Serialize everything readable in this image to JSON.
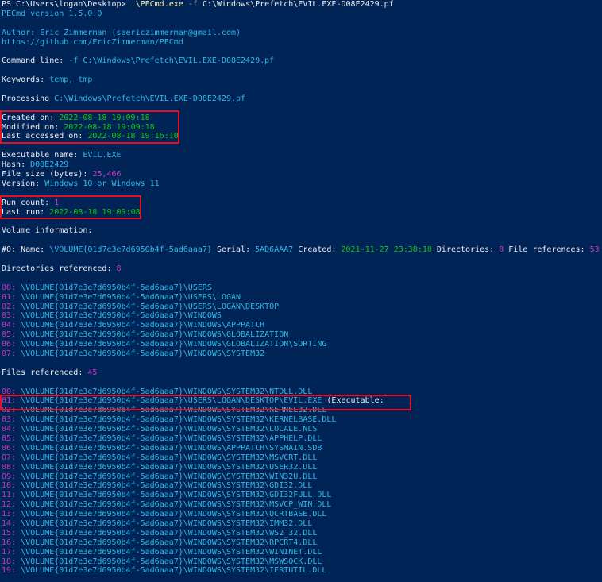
{
  "prompt": {
    "path": "PS C:\\Users\\logan\\Desktop> ",
    "command": ".\\PECmd.exe",
    "flag": "-f",
    "arg": "C:\\Windows\\Prefetch\\EVIL.EXE-D08E2429.pf"
  },
  "header": {
    "version": "PECmd version 1.5.0.0",
    "author": "Author: Eric Zimmerman (saericzimmerman@gmail.com)",
    "url": "https://github.com/EricZimmerman/PECmd"
  },
  "command_line": {
    "label": "Command line: ",
    "value": "-f C:\\Windows\\Prefetch\\EVIL.EXE-D08E2429.pf"
  },
  "keywords": {
    "label": "Keywords: ",
    "value": "temp, tmp"
  },
  "processing": {
    "label": "Processing ",
    "value": "C:\\Windows\\Prefetch\\EVIL.EXE-D08E2429.pf"
  },
  "timestamps": {
    "created_label": "Created on: ",
    "created": "2022-08-18 19:09:18",
    "modified_label": "Modified on: ",
    "modified": "2022-08-18 19:09:18",
    "accessed_label": "Last accessed on: ",
    "accessed": "2022-08-18 19:16:10"
  },
  "executable": {
    "name_label": "Executable name: ",
    "name": "EVIL.EXE",
    "hash_label": "Hash: ",
    "hash": "D08E2429",
    "size_label": "File size (bytes): ",
    "size": "25,466",
    "version_label": "Version: ",
    "version": "Windows 10 or Windows 11"
  },
  "run": {
    "count_label": "Run count: ",
    "count": "1",
    "last_label": "Last run: ",
    "last": "2022-08-18 19:09:08"
  },
  "volume": {
    "header": "Volume information:",
    "index": "#0: ",
    "name_label": "Name: ",
    "name": "\\VOLUME{01d7e3e7d6950b4f-5ad6aaa7}",
    "serial_label": " Serial: ",
    "serial": "5AD6AAA7",
    "created_label": " Created: ",
    "created": "2021-11-27 23:38:10",
    "dirs_label": " Directories: ",
    "dirs": "8",
    "files_label": " File references: ",
    "files": "53"
  },
  "directories": {
    "label": "Directories referenced: ",
    "count": "8",
    "items": [
      {
        "idx": "00: ",
        "path": "\\VOLUME{01d7e3e7d6950b4f-5ad6aaa7}\\USERS"
      },
      {
        "idx": "01: ",
        "path": "\\VOLUME{01d7e3e7d6950b4f-5ad6aaa7}\\USERS\\LOGAN"
      },
      {
        "idx": "02: ",
        "path": "\\VOLUME{01d7e3e7d6950b4f-5ad6aaa7}\\USERS\\LOGAN\\DESKTOP"
      },
      {
        "idx": "03: ",
        "path": "\\VOLUME{01d7e3e7d6950b4f-5ad6aaa7}\\WINDOWS"
      },
      {
        "idx": "04: ",
        "path": "\\VOLUME{01d7e3e7d6950b4f-5ad6aaa7}\\WINDOWS\\APPPATCH"
      },
      {
        "idx": "05: ",
        "path": "\\VOLUME{01d7e3e7d6950b4f-5ad6aaa7}\\WINDOWS\\GLOBALIZATION"
      },
      {
        "idx": "06: ",
        "path": "\\VOLUME{01d7e3e7d6950b4f-5ad6aaa7}\\WINDOWS\\GLOBALIZATION\\SORTING"
      },
      {
        "idx": "07: ",
        "path": "\\VOLUME{01d7e3e7d6950b4f-5ad6aaa7}\\WINDOWS\\SYSTEM32"
      }
    ]
  },
  "files": {
    "label": "Files referenced: ",
    "count": "45",
    "items": [
      {
        "idx": "00: ",
        "path": "\\VOLUME{01d7e3e7d6950b4f-5ad6aaa7}\\WINDOWS\\SYSTEM32\\NTDLL.DLL"
      },
      {
        "idx": "01: ",
        "path": "\\VOLUME{01d7e3e7d6950b4f-5ad6aaa7}\\USERS\\LOGAN\\DESKTOP\\EVIL.EXE",
        "suffix_open": " (Executable: ",
        "suffix_value": "True",
        "suffix_close": ")"
      },
      {
        "idx": "02: ",
        "path": "\\VOLUME{01d7e3e7d6950b4f-5ad6aaa7}\\WINDOWS\\SYSTEM32\\KERNEL32.DLL"
      },
      {
        "idx": "03: ",
        "path": "\\VOLUME{01d7e3e7d6950b4f-5ad6aaa7}\\WINDOWS\\SYSTEM32\\KERNELBASE.DLL"
      },
      {
        "idx": "04: ",
        "path": "\\VOLUME{01d7e3e7d6950b4f-5ad6aaa7}\\WINDOWS\\SYSTEM32\\LOCALE.NLS"
      },
      {
        "idx": "05: ",
        "path": "\\VOLUME{01d7e3e7d6950b4f-5ad6aaa7}\\WINDOWS\\SYSTEM32\\APPHELP.DLL"
      },
      {
        "idx": "06: ",
        "path": "\\VOLUME{01d7e3e7d6950b4f-5ad6aaa7}\\WINDOWS\\APPPATCH\\SYSMAIN.SDB"
      },
      {
        "idx": "07: ",
        "path": "\\VOLUME{01d7e3e7d6950b4f-5ad6aaa7}\\WINDOWS\\SYSTEM32\\MSVCRT.DLL"
      },
      {
        "idx": "08: ",
        "path": "\\VOLUME{01d7e3e7d6950b4f-5ad6aaa7}\\WINDOWS\\SYSTEM32\\USER32.DLL"
      },
      {
        "idx": "09: ",
        "path": "\\VOLUME{01d7e3e7d6950b4f-5ad6aaa7}\\WINDOWS\\SYSTEM32\\WIN32U.DLL"
      },
      {
        "idx": "10: ",
        "path": "\\VOLUME{01d7e3e7d6950b4f-5ad6aaa7}\\WINDOWS\\SYSTEM32\\GDI32.DLL"
      },
      {
        "idx": "11: ",
        "path": "\\VOLUME{01d7e3e7d6950b4f-5ad6aaa7}\\WINDOWS\\SYSTEM32\\GDI32FULL.DLL"
      },
      {
        "idx": "12: ",
        "path": "\\VOLUME{01d7e3e7d6950b4f-5ad6aaa7}\\WINDOWS\\SYSTEM32\\MSVCP_WIN.DLL"
      },
      {
        "idx": "13: ",
        "path": "\\VOLUME{01d7e3e7d6950b4f-5ad6aaa7}\\WINDOWS\\SYSTEM32\\UCRTBASE.DLL"
      },
      {
        "idx": "14: ",
        "path": "\\VOLUME{01d7e3e7d6950b4f-5ad6aaa7}\\WINDOWS\\SYSTEM32\\IMM32.DLL"
      },
      {
        "idx": "15: ",
        "path": "\\VOLUME{01d7e3e7d6950b4f-5ad6aaa7}\\WINDOWS\\SYSTEM32\\WS2_32.DLL"
      },
      {
        "idx": "16: ",
        "path": "\\VOLUME{01d7e3e7d6950b4f-5ad6aaa7}\\WINDOWS\\SYSTEM32\\RPCRT4.DLL"
      },
      {
        "idx": "17: ",
        "path": "\\VOLUME{01d7e3e7d6950b4f-5ad6aaa7}\\WINDOWS\\SYSTEM32\\WININET.DLL"
      },
      {
        "idx": "18: ",
        "path": "\\VOLUME{01d7e3e7d6950b4f-5ad6aaa7}\\WINDOWS\\SYSTEM32\\MSWSOCK.DLL"
      },
      {
        "idx": "19: ",
        "path": "\\VOLUME{01d7e3e7d6950b4f-5ad6aaa7}\\WINDOWS\\SYSTEM32\\IERTUTIL.DLL"
      }
    ]
  },
  "colors": {
    "background": "#012456",
    "text": "#eeedf0",
    "path": "#2fb9e6",
    "timestamp": "#16c60c",
    "number": "#c839c5",
    "command": "#f9f1a5",
    "highlight": "#e81123"
  }
}
